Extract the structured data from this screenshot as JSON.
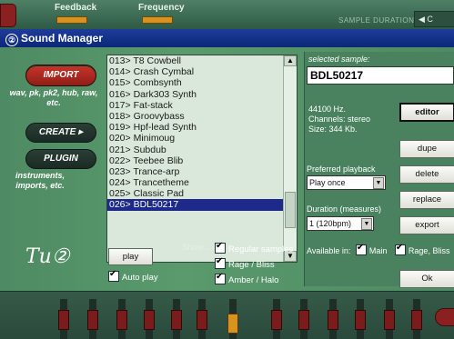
{
  "background_app": {
    "top_labels": [
      "Feedback",
      "Frequency"
    ],
    "sample_duration_label": "SAMPLE DURATION",
    "corner_button": "◀ C"
  },
  "window": {
    "title": "Sound Manager",
    "title_icon": "②"
  },
  "left": {
    "import_label": "IMPORT",
    "import_formats": "wav, pk, pk2, hub, raw, etc.",
    "create_label": "CREATE ▸",
    "plugin_label": "PLUGIN",
    "plugin_note": "instruments, imports, etc.",
    "logo_text": "Tu②"
  },
  "samples": [
    "013> T8 Cowbell",
    "014> Crash Cymbal",
    "015> Combsynth",
    "016> Dark303 Synth",
    "017> Fat-stack",
    "018> Groovybass",
    "019> Hpf-lead Synth",
    "020> Minimoug",
    "021> Subdub",
    "022> Teebee Blib",
    "023> Trance-arp",
    "024> Trancetheme",
    "025> Classic Pad",
    "026> BDL50217"
  ],
  "selected_index": 13,
  "bottom": {
    "play_label": "play",
    "auto_play_label": "Auto play",
    "auto_play_checked": true,
    "show_label": "Show...",
    "show_options": [
      {
        "label": "Regular samples",
        "checked": true
      },
      {
        "label": "Rage / Bliss",
        "checked": true
      },
      {
        "label": "Amber / Halo",
        "checked": true
      }
    ]
  },
  "right": {
    "selected_sample_label": "selected sample:",
    "selected_sample_name": "BDL50217",
    "info_lines": [
      "44100 Hz.",
      "Channels: stereo",
      "Size: 344 Kb."
    ],
    "editor_label": "editor",
    "dupe_label": "dupe",
    "delete_label": "delete",
    "replace_label": "replace",
    "export_label": "export",
    "ok_label": "Ok",
    "preferred_playback_label": "Preferred playback",
    "preferred_playback_value": "Play once",
    "duration_label": "Duration (measures)",
    "duration_value": "1 (120bpm)",
    "available_in_label": "Available in:",
    "available_main_label": "Main",
    "available_main_checked": true,
    "available_rage_label": "Rage, Bliss",
    "available_rage_checked": true
  },
  "colors": {
    "selection": "#1e2a8a",
    "title_bar": "#0b2878",
    "red_button": "#c8342a"
  }
}
